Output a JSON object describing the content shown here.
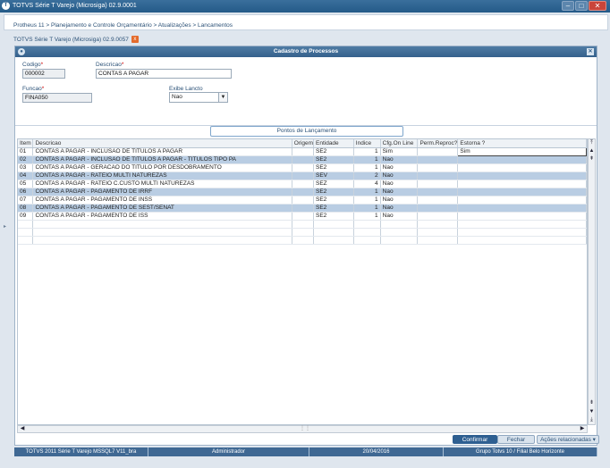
{
  "window": {
    "title": "TOTVS Série T Varejo (Microsiga) 02.9.0001",
    "logo": "T"
  },
  "breadcrumb": "Protheus 11 > Planejamento e Controle Orçamentário > Atualizações > Lancamentos",
  "tab": {
    "label": "TOTVS Série T Varejo (Microsiga) 02.9.0057",
    "close": "x"
  },
  "dialog": {
    "title": "Cadastro de Processos",
    "fields": {
      "codigo": {
        "label": "Codigo",
        "value": "000002"
      },
      "descricao": {
        "label": "Descricao",
        "value": "CONTAS A PAGAR"
      },
      "funcao": {
        "label": "Funcao",
        "value": "FINA050"
      },
      "exibe": {
        "label": "Exibe Lancto",
        "value": "Nao"
      }
    },
    "section_button": "Pontos de Lançamento",
    "grid": {
      "columns": [
        "Item",
        "Descricao",
        "Origem",
        "Entidade",
        "Indice",
        "Cfg.On Line",
        "Perm.Reproc?",
        "Estorna ?"
      ],
      "rows": [
        [
          "01",
          "CONTAS A PAGAR - INCLUSAO DE TITULOS A PAGAR",
          "",
          "SE2",
          "1",
          "Sim",
          "",
          "Sim"
        ],
        [
          "02",
          "CONTAS A PAGAR - INCLUSAO DE TITULOS A PAGAR - TITULOS TIPO PA",
          "",
          "SE2",
          "1",
          "Nao",
          "",
          ""
        ],
        [
          "03",
          "CONTAS A PAGAR - GERACAO DO TITULO POR DESDOBRAMENTO",
          "",
          "SE2",
          "1",
          "Nao",
          "",
          ""
        ],
        [
          "04",
          "CONTAS A PAGAR - RATEIO MULTI NATUREZAS",
          "",
          "SEV",
          "2",
          "Nao",
          "",
          ""
        ],
        [
          "05",
          "CONTAS A PAGAR - RATEIO C.CUSTO MULTI NATUREZAS",
          "",
          "SEZ",
          "4",
          "Nao",
          "",
          ""
        ],
        [
          "06",
          "CONTAS A PAGAR - PAGAMENTO DE IRRF",
          "",
          "SE2",
          "1",
          "Nao",
          "",
          ""
        ],
        [
          "07",
          "CONTAS A PAGAR - PAGAMENTO DE INSS",
          "",
          "SE2",
          "1",
          "Nao",
          "",
          ""
        ],
        [
          "08",
          "CONTAS A PAGAR - PAGAMENTO DE SEST/SENAT",
          "",
          "SE2",
          "1",
          "Nao",
          "",
          ""
        ],
        [
          "09",
          "CONTAS A PAGAR - PAGAMENTO DE ISS",
          "",
          "SE2",
          "1",
          "Nao",
          "",
          ""
        ]
      ]
    },
    "buttons": {
      "confirmar": "Confirmar",
      "fechar": "Fechar",
      "acoes": "Ações relacionadas"
    }
  },
  "statusbar": [
    "TOTVS 2011 Série T Varejo MSSQL7 V11_bra",
    "Administrador",
    "20/04/2016",
    "Grupo Totvs 10 / Filial Belo Horizonte"
  ],
  "colors": {
    "accent": "#2e5f91",
    "alt_row": "#b9cde3",
    "titlebar": "#245a88"
  }
}
